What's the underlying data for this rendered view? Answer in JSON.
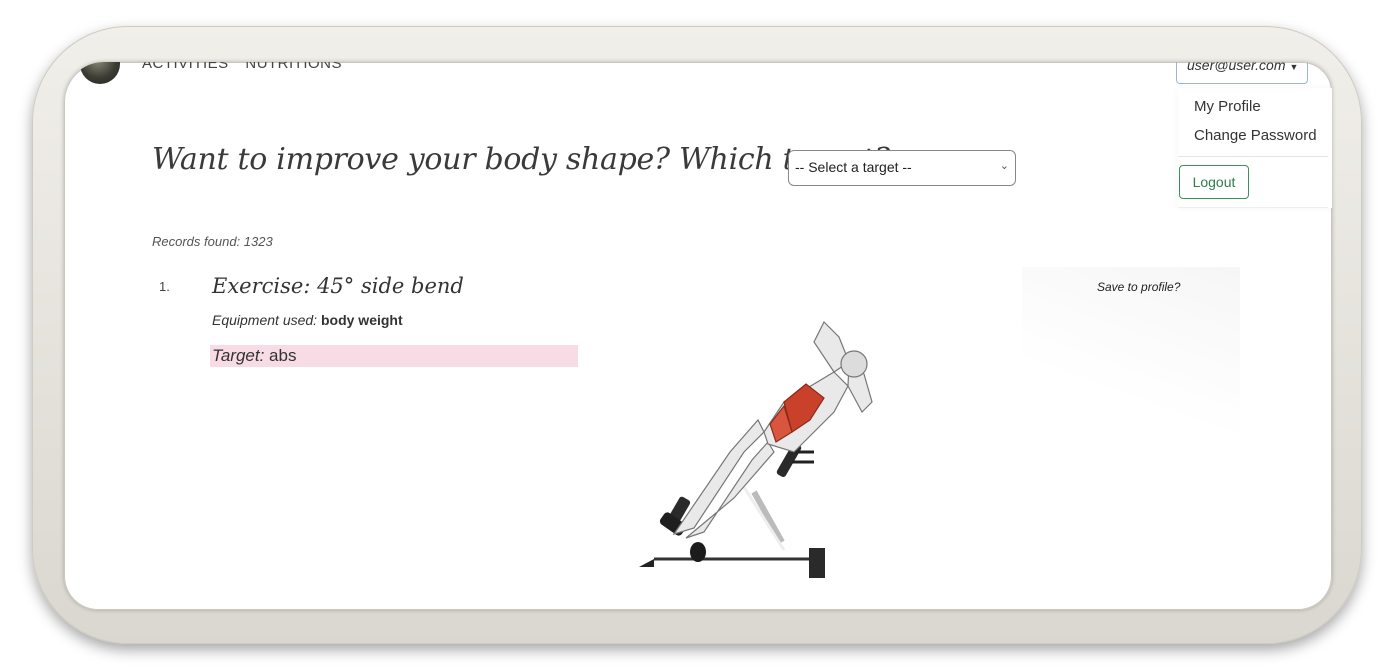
{
  "nav": {
    "links": [
      "ACTIVITIES",
      "NUTRITIONS"
    ],
    "user_email": "user@user.com",
    "menu": {
      "items": [
        "My Profile",
        "Change Password"
      ],
      "logout_label": "Logout"
    }
  },
  "main": {
    "headline": "Want to improve your body shape? Which target?",
    "select_value": "-- Select a target --",
    "records_found": "Records found: 1323"
  },
  "results": [
    {
      "index": "1.",
      "title": "Exercise: 45° side bend",
      "equipment_label": "Equipment used:",
      "equipment_value": "body weight",
      "target_label": "Target:",
      "target_value": "abs",
      "save_label": "Save to profile?"
    }
  ],
  "colors": {
    "target_highlight": "#f8dce5",
    "logout_green": "#2f7d4c",
    "muscle_highlight": "#c9412a"
  }
}
